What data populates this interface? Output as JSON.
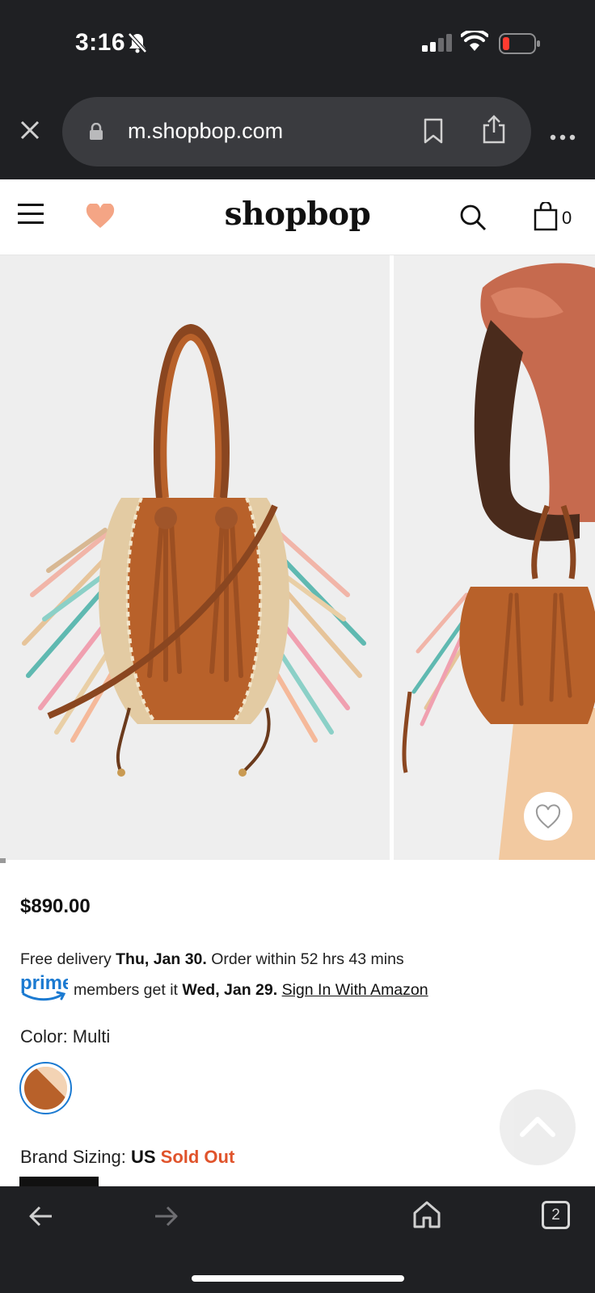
{
  "status_bar": {
    "time": "3:16",
    "icons": [
      "bell-slash-icon",
      "signal-icon",
      "wifi-icon",
      "battery-low-icon"
    ]
  },
  "browser": {
    "url": "m.shopbop.com",
    "icons": [
      "close-icon",
      "lock-icon",
      "bookmark-icon",
      "share-icon",
      "more-icon"
    ]
  },
  "header": {
    "logo": "shopbop",
    "bag_count": "0",
    "icons": [
      "menu-icon",
      "heart-icon",
      "search-icon",
      "shopping-bag-icon"
    ]
  },
  "product": {
    "price": "$890.00",
    "delivery": {
      "prefix": "Free delivery ",
      "date": "Thu, Jan 30.",
      "suffix": " Order within 52 hrs 43 mins"
    },
    "prime": {
      "logo_text": "prime",
      "prefix": "members get it ",
      "date": "Wed, Jan 29.",
      "link": "Sign In With Amazon"
    },
    "color_label": "Color: Multi",
    "sizing": {
      "label": "Brand Sizing: ",
      "unit": "US",
      "status": "Sold Out"
    }
  },
  "bottom_bar": {
    "tab_count": "2",
    "icons": [
      "back-icon",
      "forward-icon",
      "home-icon",
      "tabs-icon"
    ]
  },
  "colors": {
    "chrome": "#1f2023",
    "url_bar": "#3a3b3f",
    "heart": "#f4a585",
    "prime_blue": "#1b7ad1",
    "sold_out": "#e0532b",
    "bag_tan": "#b8612a"
  }
}
